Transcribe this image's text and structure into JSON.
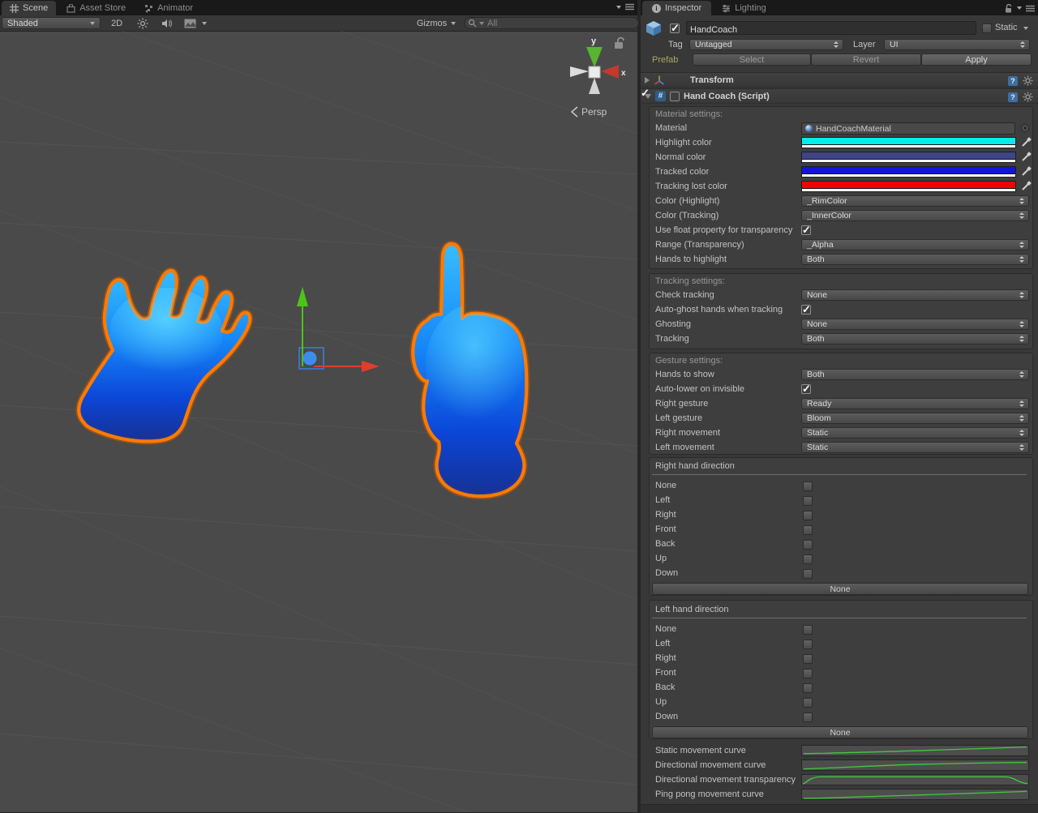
{
  "scene": {
    "tabs": {
      "scene": "Scene",
      "asset_store": "Asset Store",
      "animator": "Animator"
    },
    "toolbar": {
      "shading": "Shaded",
      "mode_2d": "2D",
      "gizmos": "Gizmos",
      "search_placeholder": "All"
    },
    "viewport": {
      "axis_y": "y",
      "axis_x": "x",
      "projection": "Persp"
    }
  },
  "inspector": {
    "tabs": {
      "inspector": "Inspector",
      "lighting": "Lighting"
    },
    "header": {
      "name": "HandCoach",
      "static": "Static",
      "tag_label": "Tag",
      "tag": "Untagged",
      "layer_label": "Layer",
      "layer": "UI",
      "prefab_label": "Prefab",
      "select": "Select",
      "revert": "Revert",
      "apply": "Apply"
    },
    "transform": {
      "title": "Transform"
    },
    "hand_coach": {
      "title": "Hand Coach (Script)",
      "material": {
        "section": "Material settings:",
        "material_label": "Material",
        "material_value": "HandCoachMaterial",
        "highlight_label": "Highlight color",
        "highlight_color": "#00EDED",
        "normal_label": "Normal color",
        "normal_color": "#3E4588",
        "tracked_label": "Tracked color",
        "tracked_color": "#1313DF",
        "lost_label": "Tracking lost color",
        "lost_color": "#F10303",
        "color_highlight_label": "Color (Highlight)",
        "color_highlight": "_RimColor",
        "color_tracking_label": "Color (Tracking)",
        "color_tracking": "_InnerColor",
        "float_label": "Use float property for transparency",
        "float_checked": true,
        "range_label": "Range (Transparency)",
        "range": "_Alpha",
        "hands_label": "Hands to highlight",
        "hands": "Both"
      },
      "tracking": {
        "section": "Tracking settings:",
        "check_label": "Check tracking",
        "check": "None",
        "autoghost_label": "Auto-ghost hands when tracking",
        "autoghost_checked": true,
        "ghosting_label": "Ghosting",
        "ghosting": "None",
        "tracking_label": "Tracking",
        "tracking": "Both"
      },
      "gesture": {
        "section": "Gesture settings:",
        "hands_show_label": "Hands to show",
        "hands_show": "Both",
        "autolower_label": "Auto-lower on invisible",
        "autolower_checked": true,
        "right_gesture_label": "Right gesture",
        "right_gesture": "Ready",
        "left_gesture_label": "Left gesture",
        "left_gesture": "Bloom",
        "right_movement_label": "Right movement",
        "right_movement": "Static",
        "left_movement_label": "Left movement",
        "left_movement": "Static"
      },
      "right_hand": {
        "title": "Right hand direction",
        "options": [
          "None",
          "Left",
          "Right",
          "Front",
          "Back",
          "Up",
          "Down"
        ],
        "button": "None"
      },
      "left_hand": {
        "title": "Left hand direction",
        "options": [
          "None",
          "Left",
          "Right",
          "Front",
          "Back",
          "Up",
          "Down"
        ],
        "button": "None"
      },
      "curves": {
        "static_label": "Static movement curve",
        "directional_label": "Directional movement curve",
        "transparency_label": "Directional movement transparency",
        "pingpong_label": "Ping pong movement curve"
      }
    }
  },
  "colors": {
    "hand_outline": "#FF7A00",
    "curve_line": "#3FCB3F",
    "prefab_text": "#B1A464"
  }
}
